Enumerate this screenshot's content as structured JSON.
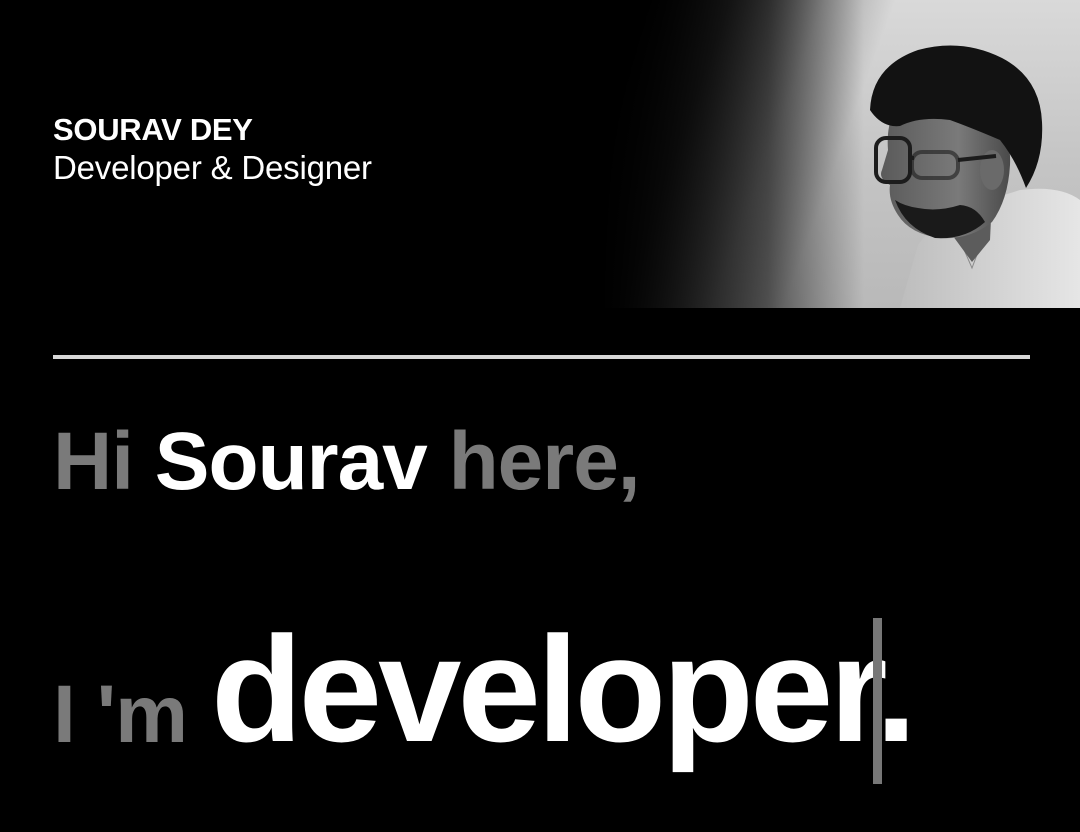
{
  "header": {
    "name": "SOURAV DEY",
    "role": "Developer & Designer"
  },
  "portrait": {
    "icon": "portrait-photo"
  },
  "hero": {
    "greeting_hi": "Hi",
    "greeting_name": "Sourav",
    "greeting_here": "here,",
    "typed_prefix": "I 'm",
    "typed_word": "developer."
  },
  "colors": {
    "background": "#000000",
    "text_bright": "#ffffff",
    "text_muted": "#7a7a7a",
    "divider": "#d8d8d8",
    "cursor": "#777777"
  }
}
